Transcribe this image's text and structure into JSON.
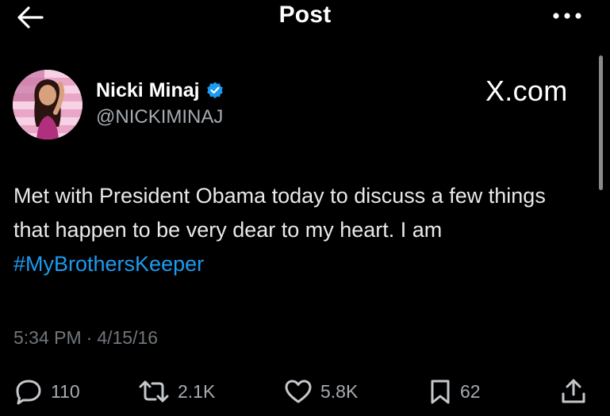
{
  "header": {
    "title": "Post",
    "back_icon": "arrow-left-icon",
    "more_icon": "more-horizontal-icon"
  },
  "author": {
    "name": "Nicki Minaj",
    "handle": "@NICKIMINAJ",
    "verified": true,
    "verified_color": "#1d9bf0"
  },
  "brand": {
    "text": "X.com"
  },
  "tweet": {
    "text_part1": "Met with President Obama today to discuss a few things that happen to be very dear to my heart. I am ",
    "hashtag": "#MyBrothersKeeper",
    "hashtag_color": "#1d9bf0"
  },
  "meta": {
    "time": "5:34 PM",
    "separator": "·",
    "date": "4/15/16"
  },
  "actions": {
    "replies": "110",
    "reposts": "2.1K",
    "likes": "5.8K",
    "bookmarks": "62"
  }
}
